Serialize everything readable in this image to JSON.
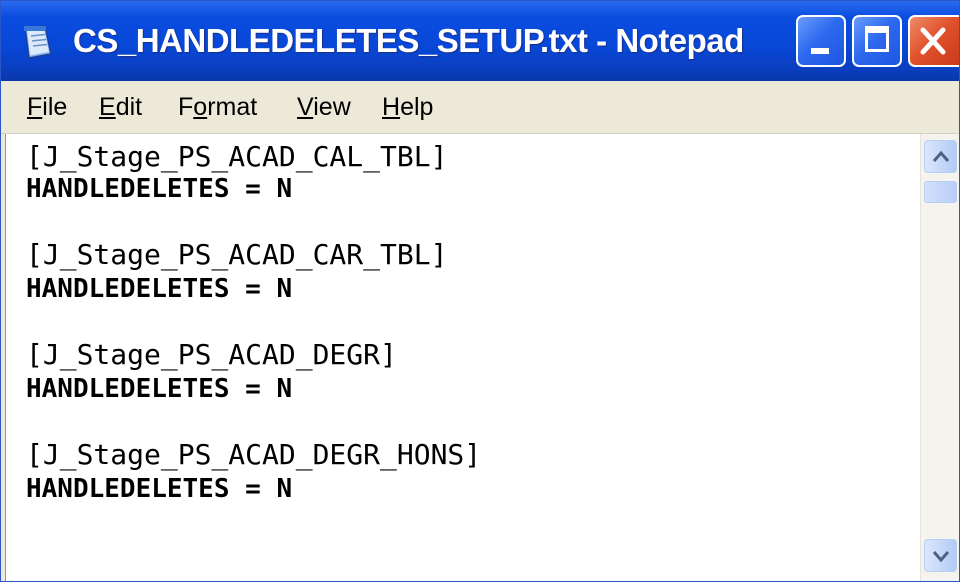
{
  "window": {
    "title": "CS_HANDLEDELETES_SETUP.txt - Notepad",
    "app_icon": "notepad-icon",
    "controls": [
      {
        "name": "minimize",
        "icon": "minimize-icon"
      },
      {
        "name": "maximize",
        "icon": "maximize-icon"
      },
      {
        "name": "close",
        "icon": "close-icon"
      }
    ]
  },
  "menu": {
    "items": [
      {
        "label": "File",
        "mnemonic": "F",
        "rest": "ile"
      },
      {
        "label": "Edit",
        "mnemonic": "E",
        "rest": "dit"
      },
      {
        "label": "Format",
        "pre": "F",
        "mnemonic": "o",
        "rest": "rmat"
      },
      {
        "label": "View",
        "mnemonic": "V",
        "rest": "iew"
      },
      {
        "label": "Help",
        "mnemonic": "H",
        "rest": "elp"
      }
    ]
  },
  "document": {
    "lines": [
      "[J_Stage_PS_ACAD_CAL_TBL]",
      "HANDLEDELETES = N",
      "",
      "[J_Stage_PS_ACAD_CAR_TBL]",
      "HANDLEDELETES = N",
      "",
      "[J_Stage_PS_ACAD_DEGR]",
      "HANDLEDELETES = N",
      "",
      "[J_Stage_PS_ACAD_DEGR_HONS]",
      "HANDLEDELETES = N"
    ]
  },
  "scrollbar": {
    "up_icon": "scroll-up-arrow-icon",
    "down_icon": "scroll-down-arrow-icon"
  },
  "colors": {
    "titlebar": "#0847d8",
    "title_text": "#ffffff",
    "close_button": "#e0502a",
    "menubar": "#ece9d8",
    "editor_bg": "#ffffff"
  }
}
